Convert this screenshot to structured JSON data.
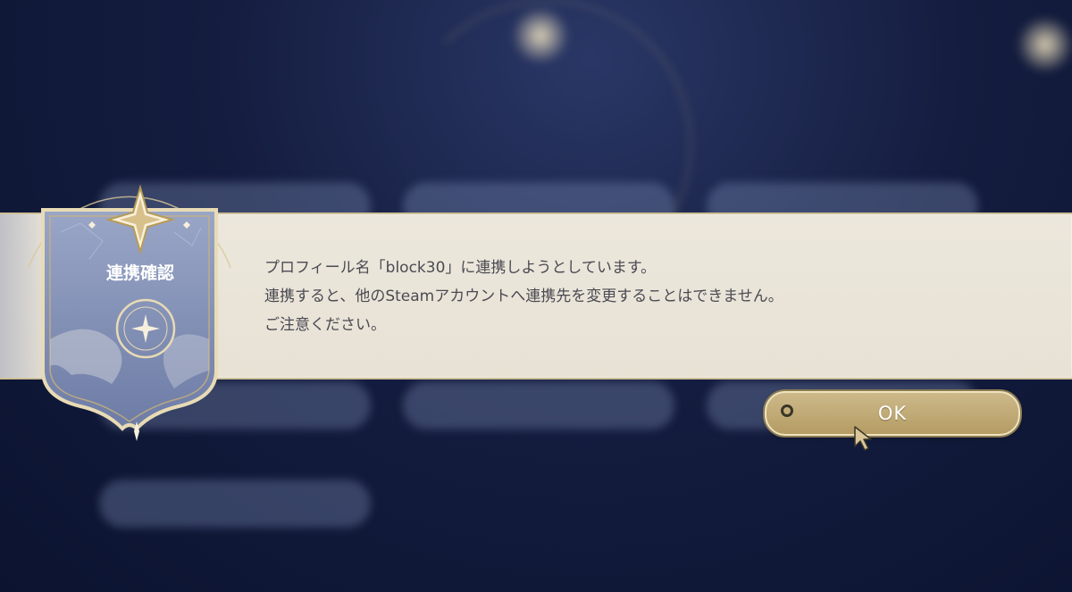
{
  "dialog": {
    "title": "連携確認",
    "message_lines": [
      "プロフィール名「block30」に連携しようとしています。",
      "連携すると、他のSteamアカウントへ連携先を変更することはできません。",
      "ご注意ください。"
    ],
    "ok_label": "OK"
  },
  "colors": {
    "banner": "#ece7dc",
    "crest_blue": "#7e8db5",
    "gold": "#c9b27a",
    "ok_button": "#c2ab76",
    "text": "#4a4a52",
    "background": "#141d3f"
  },
  "icons": {
    "crest_star": "compass-star-icon",
    "emblem": "moon-star-emblem-icon",
    "ok_ring": "circle-button-hint-icon",
    "cursor": "pointer-cursor-icon"
  }
}
